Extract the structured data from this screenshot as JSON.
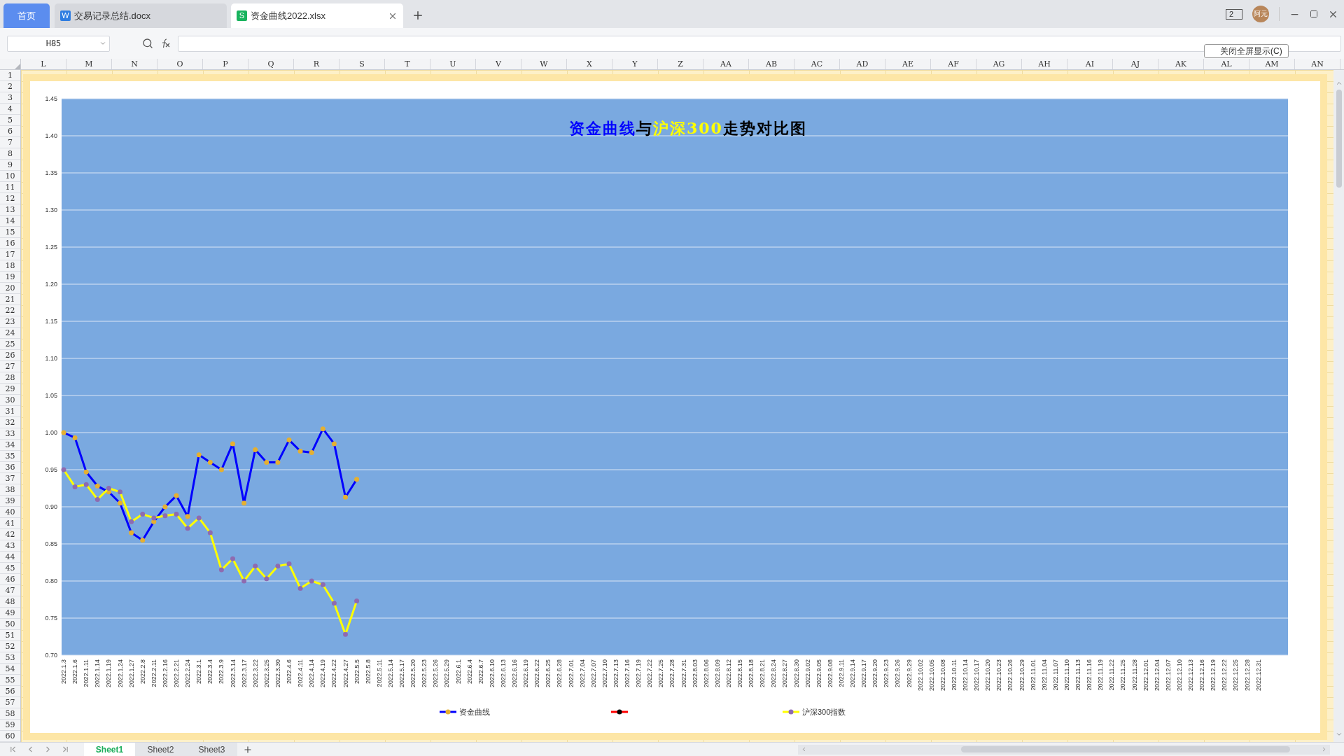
{
  "tabs": [
    {
      "kind": "home",
      "label": "首页",
      "selected": false
    },
    {
      "kind": "writer",
      "badge": "W",
      "label": "交易记录总结.docx",
      "selected": false
    },
    {
      "kind": "spreadsheet",
      "badge": "S",
      "label": "资金曲线2022.xlsx",
      "selected": true
    }
  ],
  "title_bar": {
    "screen_button": "2",
    "avatar": "阿元"
  },
  "formula_bar": {
    "name_box": "H85"
  },
  "fullscreen_button": "关闭全屏显示(C)",
  "columns": [
    "L",
    "M",
    "N",
    "O",
    "P",
    "Q",
    "R",
    "S",
    "T",
    "U",
    "V",
    "W",
    "X",
    "Y",
    "Z",
    "AA",
    "AB",
    "AC",
    "AD",
    "AE",
    "AF",
    "AG",
    "AH",
    "AI",
    "AJ",
    "AK",
    "AL",
    "AM",
    "AN"
  ],
  "rows": [
    "1",
    "2",
    "3",
    "4",
    "5",
    "6",
    "7",
    "8",
    "9",
    "10",
    "11",
    "12",
    "13",
    "14",
    "15",
    "16",
    "17",
    "18",
    "19",
    "20",
    "21",
    "22",
    "23",
    "24",
    "25",
    "26",
    "27",
    "28",
    "29",
    "30",
    "31",
    "32",
    "33",
    "34",
    "35",
    "36",
    "37",
    "38",
    "39",
    "40",
    "41",
    "42",
    "43",
    "44",
    "45",
    "46",
    "47",
    "48",
    "49",
    "50",
    "51",
    "52",
    "53",
    "54",
    "55",
    "56",
    "57",
    "58",
    "59",
    "60"
  ],
  "chart": {
    "markers": [
      {
        "color": "#e6b030"
      },
      {
        "color": "#000000"
      },
      {
        "color": "#8e6bb0"
      }
    ],
    "title": [
      {
        "text": "资金曲线",
        "color": "#0000ff"
      },
      {
        "text": "与",
        "color": "#000000"
      },
      {
        "text": "沪深300",
        "color": "#ffff00"
      },
      {
        "text": "走势对比图",
        "color": "#000000"
      }
    ],
    "chart_data": {
      "type": "line",
      "grid": true,
      "legend": "bottom",
      "ylim": [
        0.7,
        1.45
      ],
      "yticks": [
        {
          "value": 0.7,
          "label": "0.70"
        },
        {
          "value": 0.75,
          "label": "0.75"
        },
        {
          "value": 0.8,
          "label": "0.80"
        },
        {
          "value": 0.85,
          "label": "0.85"
        },
        {
          "value": 0.9,
          "label": "0.90"
        },
        {
          "value": 0.95,
          "label": "0.95"
        },
        {
          "value": 1.0,
          "label": "1.00"
        },
        {
          "value": 1.05,
          "label": "1.05"
        },
        {
          "value": 1.1,
          "label": "1.10"
        },
        {
          "value": 1.15,
          "label": "1.15"
        },
        {
          "value": 1.2,
          "label": "1.20"
        },
        {
          "value": 1.25,
          "label": "1.25"
        },
        {
          "value": 1.3,
          "label": "1.30"
        },
        {
          "value": 1.35,
          "label": "1.35"
        },
        {
          "value": 1.4,
          "label": "1.40"
        },
        {
          "value": 1.45,
          "label": "1.45"
        }
      ],
      "categories": [
        "2022.1.3",
        "2022.1.6",
        "2022.1.11",
        "2022.1.14",
        "2022.1.19",
        "2022.1.24",
        "2022.1.27",
        "2022.2.8",
        "2022.2.11",
        "2022.2.16",
        "2022.2.21",
        "2022.2.24",
        "2022.3.1",
        "2022.3.4",
        "2022.3.9",
        "2022.3.14",
        "2022.3.17",
        "2022.3.22",
        "2022.3.25",
        "2022.3.30",
        "2022.4.6",
        "2022.4.11",
        "2022.4.14",
        "2022.4.19",
        "2022.4.22",
        "2022.4.27",
        "2022.5.5",
        "2022.5.8",
        "2022.5.11",
        "2022.5.14",
        "2022.5.17",
        "2022.5.20",
        "2022.5.23",
        "2022.5.26",
        "2022.5.29",
        "2022.6.1",
        "2022.6.4",
        "2022.6.7",
        "2022.6.10",
        "2022.6.13",
        "2022.6.16",
        "2022.6.19",
        "2022.6.22",
        "2022.6.25",
        "2022.6.28",
        "2022.7.01",
        "2022.7.04",
        "2022.7.07",
        "2022.7.10",
        "2022.7.13",
        "2022.7.16",
        "2022.7.19",
        "2022.7.22",
        "2022.7.25",
        "2022.7.28",
        "2022.7.31",
        "2022.8.03",
        "2022.8.06",
        "2022.8.09",
        "2022.8.12",
        "2022.8.15",
        "2022.8.18",
        "2022.8.21",
        "2022.8.24",
        "2022.8.27",
        "2022.8.30",
        "2022.9.02",
        "2022.9.05",
        "2022.9.08",
        "2022.9.11",
        "2022.9.14",
        "2022.9.17",
        "2022.9.20",
        "2022.9.23",
        "2022.9.26",
        "2022.9.29",
        "2022.10.02",
        "2022.10.05",
        "2022.10.08",
        "2022.10.11",
        "2022.10.14",
        "2022.10.17",
        "2022.10.20",
        "2022.10.23",
        "2022.10.26",
        "2022.10.29",
        "2022.11.01",
        "2022.11.04",
        "2022.11.07",
        "2022.11.10",
        "2022.11.13",
        "2022.11.16",
        "2022.11.19",
        "2022.11.22",
        "2022.11.25",
        "2022.11.28",
        "2022.12.01",
        "2022.12.04",
        "2022.12.07",
        "2022.12.10",
        "2022.12.13",
        "2022.12.16",
        "2022.12.19",
        "2022.12.22",
        "2022.12.25",
        "2022.12.28",
        "2022.12.31"
      ],
      "series": [
        {
          "name": "资金曲线",
          "color": "#0000ff",
          "marker": "circle",
          "values": [
            1.0,
            0.993,
            0.947,
            0.928,
            0.92,
            0.905,
            0.865,
            0.855,
            0.88,
            0.9,
            0.915,
            0.887,
            0.97,
            0.96,
            0.95,
            0.985,
            0.905,
            0.977,
            0.96,
            0.96,
            0.99,
            0.975,
            0.973,
            1.005,
            0.985,
            0.913,
            0.937,
            null,
            null,
            null,
            null,
            null,
            null,
            null,
            null,
            null,
            null,
            null,
            null,
            null,
            null,
            null,
            null,
            null,
            null,
            null,
            null,
            null,
            null,
            null,
            null,
            null,
            null,
            null,
            null,
            null,
            null,
            null,
            null,
            null,
            null,
            null,
            null,
            null,
            null,
            null,
            null,
            null,
            null,
            null,
            null,
            null,
            null,
            null,
            null,
            null,
            null,
            null,
            null,
            null,
            null,
            null,
            null,
            null,
            null,
            null,
            null,
            null,
            null,
            null,
            null,
            null,
            null,
            null,
            null,
            null,
            null,
            null,
            null,
            null,
            null,
            null,
            null,
            null,
            null,
            null,
            null
          ]
        },
        {
          "color": "#ff0000",
          "marker": "circle",
          "values": [
            null,
            null,
            null,
            null,
            null,
            null,
            null,
            null,
            null,
            null,
            null,
            null,
            null,
            null,
            null,
            null,
            null,
            null,
            null,
            null,
            null,
            null,
            null,
            null,
            null,
            null,
            null,
            null,
            null,
            null,
            null,
            null,
            null,
            null,
            null,
            null,
            null,
            null,
            null,
            null,
            null,
            null,
            null,
            null,
            null,
            null,
            null,
            null,
            null,
            null,
            null,
            null,
            null,
            null,
            null,
            null,
            null,
            null,
            null,
            null,
            null,
            null,
            null,
            null,
            null,
            null,
            null,
            null,
            null,
            null,
            null,
            null,
            null,
            null,
            null,
            null,
            null,
            null,
            null,
            null,
            null,
            null,
            null,
            null,
            null,
            null,
            null,
            null,
            null,
            null,
            null,
            null,
            null,
            null,
            null,
            null,
            null,
            null,
            null,
            null,
            null,
            null,
            null,
            null,
            null,
            null,
            null
          ]
        },
        {
          "name": "沪深300指数",
          "color": "#ffff00",
          "marker": "circle",
          "values": [
            0.95,
            0.927,
            0.93,
            0.91,
            0.925,
            0.92,
            0.88,
            0.89,
            0.885,
            0.888,
            0.89,
            0.871,
            0.885,
            0.865,
            0.815,
            0.83,
            0.8,
            0.82,
            0.803,
            0.82,
            0.823,
            0.79,
            0.8,
            0.795,
            0.77,
            0.728,
            0.773,
            null,
            null,
            null,
            null,
            null,
            null,
            null,
            null,
            null,
            null,
            null,
            null,
            null,
            null,
            null,
            null,
            null,
            null,
            null,
            null,
            null,
            null,
            null,
            null,
            null,
            null,
            null,
            null,
            null,
            null,
            null,
            null,
            null,
            null,
            null,
            null,
            null,
            null,
            null,
            null,
            null,
            null,
            null,
            null,
            null,
            null,
            null,
            null,
            null,
            null,
            null,
            null,
            null,
            null,
            null,
            null,
            null,
            null,
            null,
            null,
            null,
            null,
            null,
            null,
            null,
            null,
            null,
            null,
            null,
            null,
            null,
            null,
            null,
            null,
            null,
            null,
            null,
            null,
            null,
            null
          ]
        }
      ]
    }
  },
  "sheets": [
    {
      "label": "Sheet1",
      "selected": true
    },
    {
      "label": "Sheet2",
      "selected": false
    },
    {
      "label": "Sheet3",
      "selected": false
    }
  ]
}
